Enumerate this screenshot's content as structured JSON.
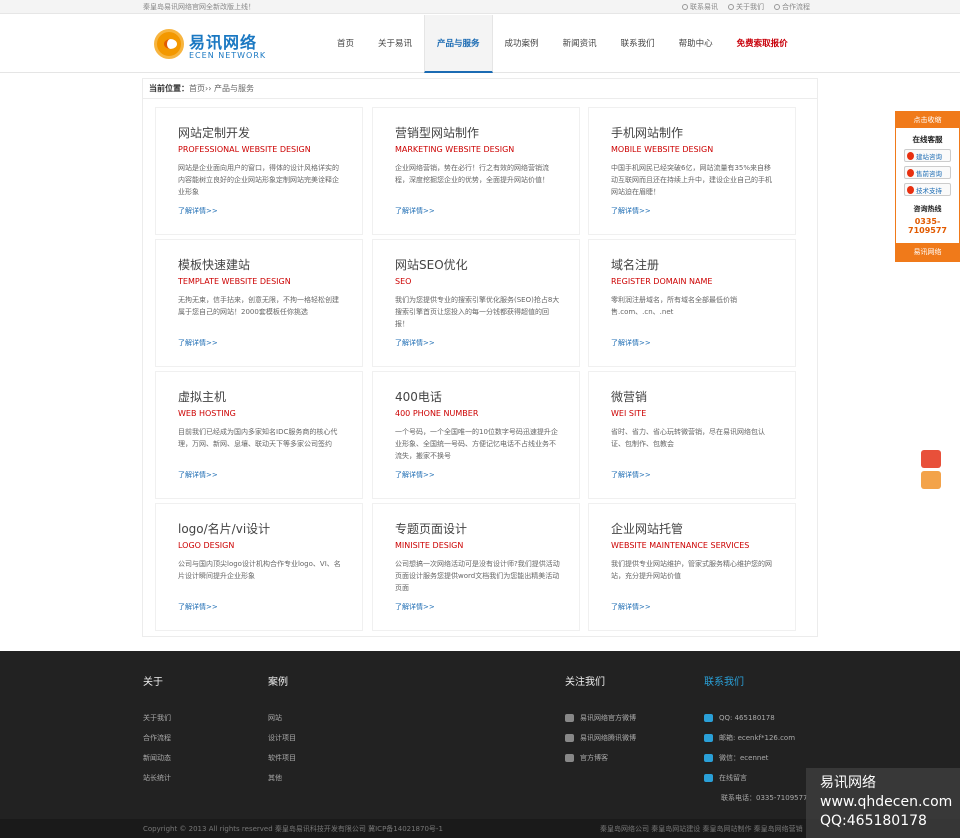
{
  "topbar": {
    "notice": "秦皇岛易讯网络官网全新改版上线！",
    "links": [
      "联系易讯",
      "关于我们",
      "合作流程"
    ]
  },
  "logo": {
    "cn": "易讯网络",
    "en": "ECEN NETWORK"
  },
  "nav": [
    "首页",
    "关于易讯",
    "产品与服务",
    "成功案例",
    "新闻资讯",
    "联系我们",
    "帮助中心",
    "免费索取报价"
  ],
  "breadcrumb": {
    "label": "当前位置：",
    "path": "首页›› 产品与服务"
  },
  "cards": [
    {
      "title": "网站定制开发",
      "en": "PROFESSIONAL WEBSITE DESIGN",
      "desc": "网站是企业面向用户的窗口，得体的设计风格详实的内容能树立良好的企业网站形象定制网站完美诠释企业形象",
      "more": "了解详情>>"
    },
    {
      "title": "营销型网站制作",
      "en": "MARKETING WEBSITE DESIGN",
      "desc": "企业网络营销，势在必行！行之有效的网络营销流程，深度挖掘您企业的优势，全面提升网站价值！",
      "more": "了解详情>>"
    },
    {
      "title": "手机网站制作",
      "en": "MOBILE WEBSITE DESIGN",
      "desc": "中国手机网民已经突破6亿，网站流量有35%来自移动互联网而且还在持续上升中，建设企业自己的手机网站迫在眉睫！",
      "more": "了解详情>>"
    },
    {
      "title": "模板快速建站",
      "en": "TEMPLATE WEBSITE DESIGN",
      "desc": "无拘无束，信手拈来，创意无限，不拘一格轻松创建属于您自己的网站！2000套模板任你挑选",
      "more": "了解详情>>"
    },
    {
      "title": "网站SEO优化",
      "en": "SEO",
      "desc": "我们为您提供专业的搜索引擎优化服务(SEO)抢占8大搜索引擎首页让您投入的每一分钱都获得超值的回报！",
      "more": "了解详情>>"
    },
    {
      "title": "域名注册",
      "en": "REGISTER DOMAIN NAME",
      "desc": "零利润注册域名，所有域名全部最低价销售.com、.cn、.net",
      "more": "了解详情>>"
    },
    {
      "title": "虚拟主机",
      "en": "WEB HOSTING",
      "desc": "目前我们已经成为国内多家知名IDC服务商的核心代理，万网、新网、息壤、联动天下等多家公司签约",
      "more": "了解详情>>"
    },
    {
      "title": "400电话",
      "en": "400 PHONE NUMBER",
      "desc": "一个号码，一个全国唯一的10位数字号码迅速提升企业形象、全国统一号码、方便记忆电话不占线业务不流失，搬家不换号",
      "more": "了解详情>>"
    },
    {
      "title": "微营销",
      "en": "WEI SITE",
      "desc": "省时、省力、省心玩转微营销，尽在易讯网络包认证、包制作、包教会",
      "more": "了解详情>>"
    },
    {
      "title": "logo/名片/vi设计",
      "en": "LOGO DESIGN",
      "desc": "公司与国内顶尖logo设计机构合作专业logo、VI、名片设计瞬间提升企业形象",
      "more": "了解详情>>"
    },
    {
      "title": "专题页面设计",
      "en": "MINISITE DESIGN",
      "desc": "公司想搞一次网络活动可是没有设计师?我们提供活动页面设计服务您提供word文档我们为您能出精美活动页面",
      "more": "了解详情>>"
    },
    {
      "title": "企业网站托管",
      "en": "WEBSITE MAINTENANCE SERVICES",
      "desc": "我们提供专业网站维护，管家式服务精心维护您的网站，充分提升网站价值",
      "more": "了解详情>>"
    }
  ],
  "footer": {
    "about": {
      "title": "关于",
      "items": [
        "关于我们",
        "合作流程",
        "新闻动态",
        "站长统计"
      ]
    },
    "cases": {
      "title": "案例",
      "items": [
        "网站",
        "设计项目",
        "软件项目",
        "其他"
      ]
    },
    "follow": {
      "title": "关注我们",
      "items": [
        "易讯网络官方微博",
        "易讯网络腾讯微博",
        "官方博客"
      ]
    },
    "contact": {
      "title": "联系我们",
      "items": [
        "QQ: 465180178",
        "邮箱: ecenkf*126.com",
        "微信：ecennet",
        "在线留言"
      ],
      "phone": "联系电话：0335-7109577"
    },
    "copyright": "Copyright © 2013 All rights reserved  秦皇岛易讯科技开发有限公司 冀ICP备14021870号-1",
    "right": "秦皇岛网络公司 秦皇岛网站建设 秦皇岛网站制作 秦皇岛网络营销"
  },
  "side": {
    "top": "点击收缩",
    "label": "在线客服",
    "qq": [
      "建站咨询",
      "售前咨询",
      "技术支持"
    ],
    "hotline": "咨询热线",
    "phone": "0335-7109577",
    "bottom": "易讯网络"
  },
  "watermark": [
    "易讯网络",
    "www.qhdecen.com",
    "QQ:465180178"
  ],
  "colors": {
    "accent": "#1b6bb3",
    "red": "#cc0000",
    "orange": "#f07a1a",
    "footer": "#222222"
  }
}
